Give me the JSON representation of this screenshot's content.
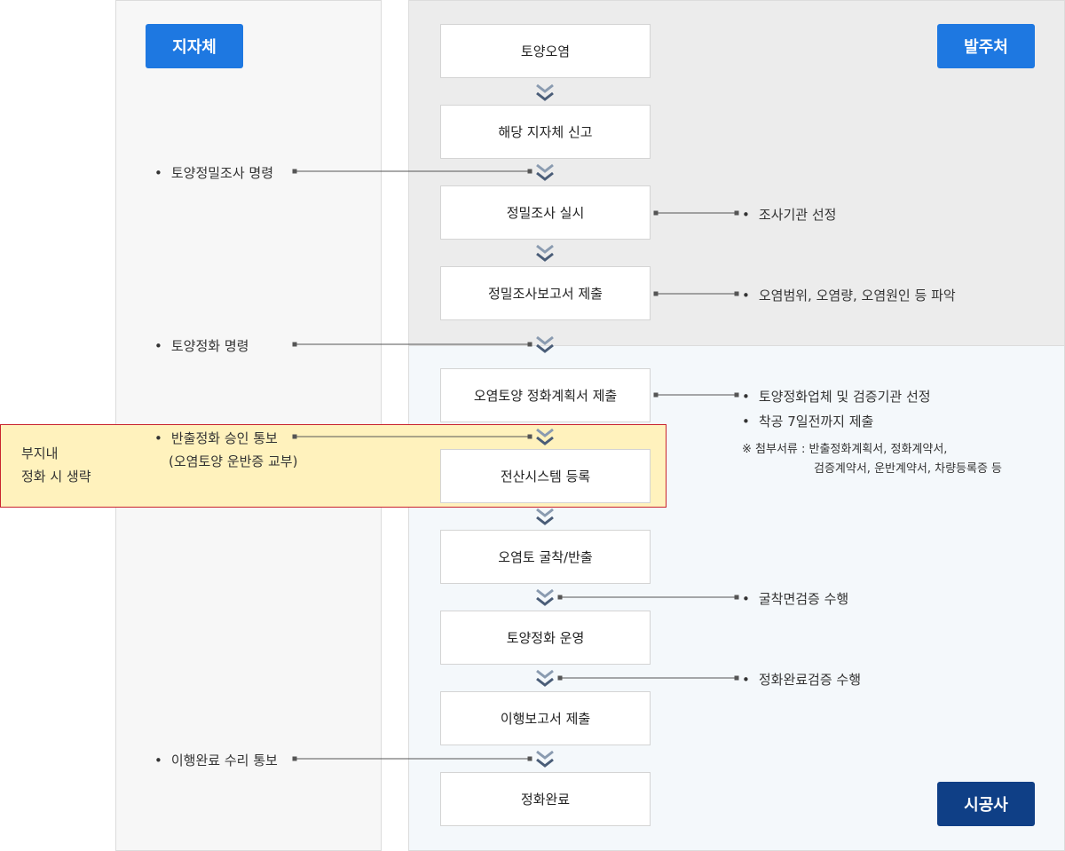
{
  "colors": {
    "agency_button": "#1e78e1",
    "orderer_button": "#1e78e1",
    "contractor_button": "#0f3f86",
    "chevron": "#4a5d78",
    "highlight_border": "#c9242e",
    "highlight_fill": "#fff2bd"
  },
  "roles": {
    "local_government": "지자체",
    "orderer": "발주처",
    "contractor": "시공사"
  },
  "steps": [
    "토양오염",
    "해당 지자체 신고",
    "정밀조사 실시",
    "정밀조사보고서 제출",
    "오염토양 정화계획서 제출",
    "전산시스템 등록",
    "오염토 굴착/반출",
    "토양정화 운영",
    "이행보고서 제출",
    "정화완료"
  ],
  "left_notes": [
    "토양정밀조사 명령",
    "토양정화 명령",
    "반출정화 승인 통보",
    "(오염토양 운반증 교부)",
    "이행완료 수리 통보"
  ],
  "right_notes": [
    "조사기관 선정",
    "오염범위, 오염량, 오염원인 등 파악",
    "토양정화업체 및 검증기관 선정",
    "착공 7일전까지 제출",
    "※ 첨부서류 : 반출정화계획서, 정화계약서,",
    "검증계약서, 운반계약서, 차량등록증 등",
    "굴착면검증 수행",
    "정화완료검증 수행"
  ],
  "highlight": {
    "line1": "부지내",
    "line2": "정화 시 생략"
  }
}
